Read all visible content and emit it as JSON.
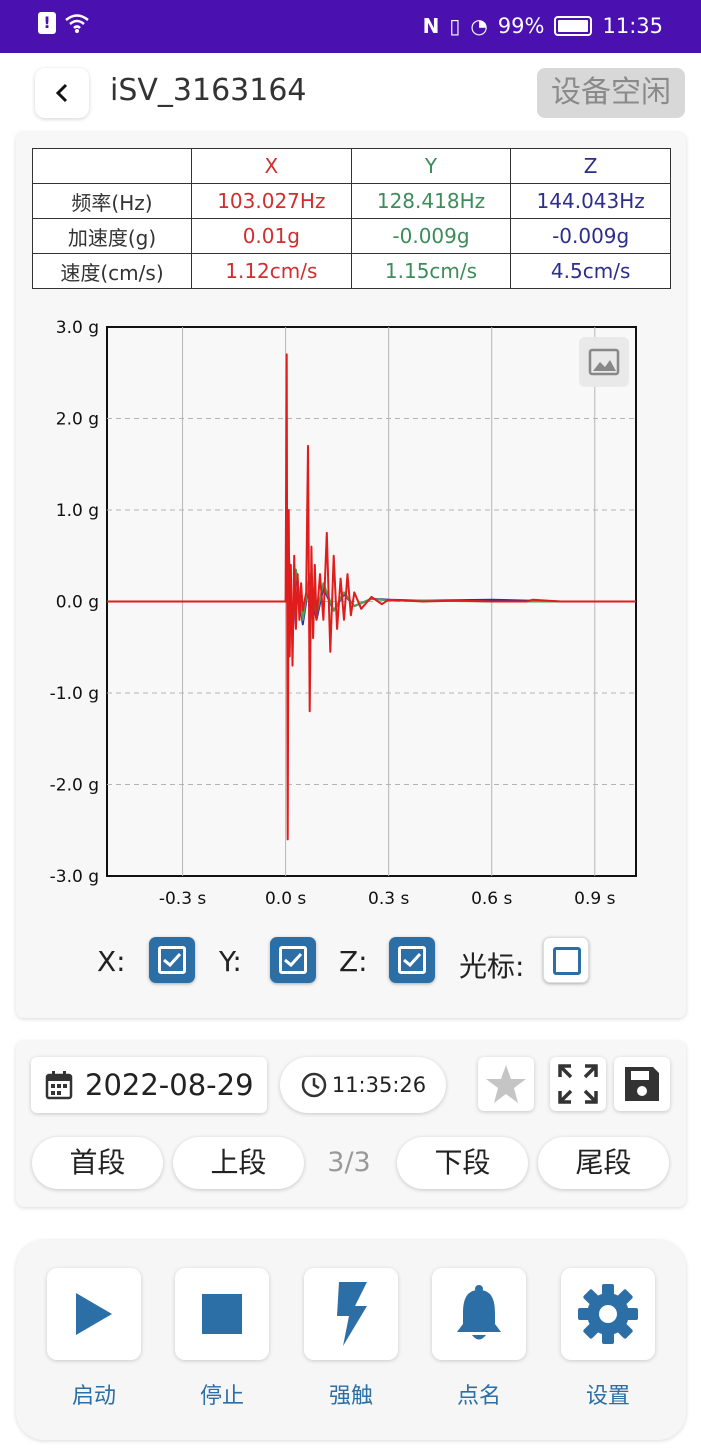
{
  "status_bar": {
    "battery": "99%",
    "time": "11:35",
    "icons": [
      "alert-icon",
      "wifi-icon",
      "nfc-icon",
      "vibrate-icon",
      "data-saver-icon",
      "battery-icon"
    ]
  },
  "header": {
    "title": "iSV_3163164",
    "status_button": "设备空闲"
  },
  "stats_table": {
    "columns": [
      "X",
      "Y",
      "Z"
    ],
    "rows": [
      {
        "label": "频率(Hz)",
        "x": "103.027Hz",
        "y": "128.418Hz",
        "z": "144.043Hz"
      },
      {
        "label": "加速度(g)",
        "x": "0.01g",
        "y": "-0.009g",
        "z": "-0.009g"
      },
      {
        "label": "速度(cm/s)",
        "x": "1.12cm/s",
        "y": "1.15cm/s",
        "z": "4.5cm/s"
      }
    ]
  },
  "chart_data": {
    "type": "line",
    "title": "",
    "xlabel": "",
    "ylabel": "",
    "xlim": [
      -0.52,
      1.02
    ],
    "ylim": [
      -3.0,
      3.0
    ],
    "x_ticks": [
      "-0.3 s",
      "0.0 s",
      "0.3 s",
      "0.6 s",
      "0.9 s"
    ],
    "x_tick_values": [
      -0.3,
      0.0,
      0.3,
      0.6,
      0.9
    ],
    "y_ticks": [
      "3.0 g",
      "2.0 g",
      "1.0 g",
      "0.0 g",
      "-1.0 g",
      "-2.0 g",
      "-3.0 g"
    ],
    "y_tick_values": [
      3.0,
      2.0,
      1.0,
      0.0,
      -1.0,
      -2.0,
      -3.0
    ],
    "grid": true,
    "series": [
      {
        "color": "#2c2cb0",
        "x": [
          -0.52,
          -0.1,
          0.0,
          0.01,
          0.02,
          0.03,
          0.05,
          0.07,
          0.09,
          0.11,
          0.14,
          0.17,
          0.2,
          0.25,
          0.3,
          0.4,
          0.6,
          0.8,
          1.02
        ],
        "y": [
          0.0,
          0.0,
          0.0,
          0.45,
          -0.4,
          0.3,
          -0.25,
          0.25,
          -0.2,
          0.15,
          -0.1,
          0.08,
          -0.05,
          0.03,
          0.02,
          0.01,
          0.02,
          0.0,
          0.0
        ]
      },
      {
        "color": "#4fa24f",
        "x": [
          -0.52,
          -0.1,
          0.0,
          0.01,
          0.02,
          0.03,
          0.05,
          0.07,
          0.09,
          0.11,
          0.14,
          0.17,
          0.2,
          0.25,
          0.3,
          0.4,
          0.6,
          0.8,
          1.02
        ],
        "y": [
          0.0,
          0.0,
          0.0,
          0.4,
          -0.3,
          0.35,
          -0.2,
          0.3,
          -0.15,
          0.2,
          -0.1,
          0.1,
          -0.05,
          0.03,
          0.01,
          0.01,
          0.0,
          0.0,
          0.0
        ]
      },
      {
        "color": "#e01c1c",
        "x": [
          -0.52,
          -0.3,
          -0.1,
          0.0,
          0.003,
          0.006,
          0.009,
          0.012,
          0.015,
          0.02,
          0.025,
          0.03,
          0.035,
          0.04,
          0.045,
          0.05,
          0.06,
          0.065,
          0.07,
          0.075,
          0.08,
          0.085,
          0.09,
          0.1,
          0.11,
          0.12,
          0.13,
          0.14,
          0.15,
          0.16,
          0.17,
          0.18,
          0.19,
          0.2,
          0.22,
          0.25,
          0.28,
          0.3,
          0.35,
          0.4,
          0.5,
          0.6,
          0.7,
          0.72,
          0.8,
          0.9,
          1.02
        ],
        "y": [
          0.0,
          0.0,
          0.0,
          0.0,
          2.7,
          -2.6,
          1.0,
          -0.6,
          0.4,
          -0.7,
          0.5,
          -0.3,
          0.3,
          -0.2,
          0.2,
          -0.1,
          0.1,
          1.7,
          -1.2,
          0.6,
          -0.4,
          0.4,
          -0.2,
          0.3,
          -0.2,
          0.75,
          -0.55,
          0.5,
          -0.3,
          0.25,
          -0.2,
          0.3,
          -0.15,
          0.1,
          -0.08,
          0.05,
          -0.03,
          0.02,
          0.01,
          0.0,
          0.01,
          0.0,
          0.0,
          0.02,
          0.0,
          0.0,
          0.0
        ]
      }
    ]
  },
  "checkboxes": {
    "x_label": "X:",
    "y_label": "Y:",
    "z_label": "Z:",
    "cursor_label": "光标:",
    "x_checked": true,
    "y_checked": true,
    "z_checked": true,
    "cursor_checked": false
  },
  "controls": {
    "date": "2022-08-29",
    "time": "11:35:26",
    "first_segment": "首段",
    "prev_segment": "上段",
    "segment_indicator": "3/3",
    "next_segment": "下段",
    "last_segment": "尾段"
  },
  "toolbar": {
    "start": "启动",
    "stop": "停止",
    "force_trigger": "强触",
    "roll_call": "点名",
    "settings": "设置"
  },
  "colors": {
    "status_bar": "#4a10b0",
    "accent": "#2c6ea6",
    "x_channel": "#d22e2e",
    "y_channel": "#3d8c5a",
    "z_channel": "#2d2d8c"
  }
}
